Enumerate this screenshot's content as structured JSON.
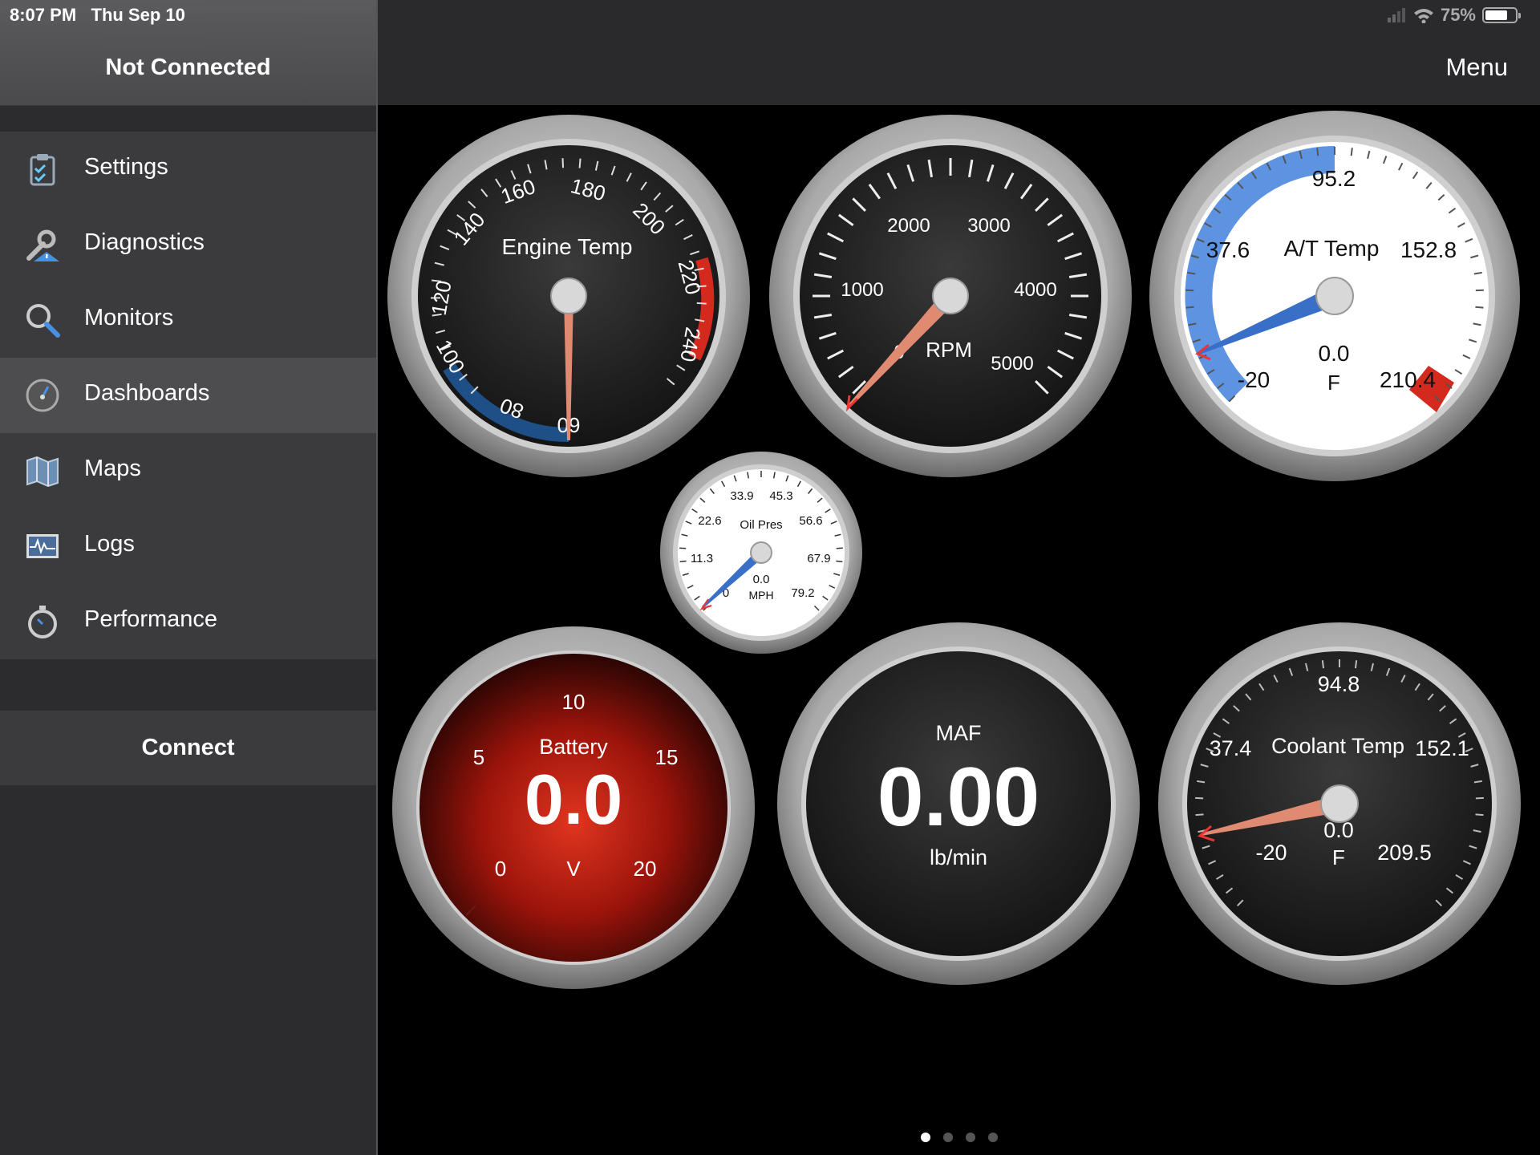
{
  "status_bar": {
    "time": "8:07 PM",
    "date": "Thu Sep 10",
    "battery": "75%",
    "battery_level": 0.75
  },
  "sidebar": {
    "title": "Not Connected",
    "items": [
      {
        "label": "Settings",
        "icon": "clipboard-check-icon",
        "active": false
      },
      {
        "label": "Diagnostics",
        "icon": "wrench-warning-icon",
        "active": false
      },
      {
        "label": "Monitors",
        "icon": "magnifier-icon",
        "active": false
      },
      {
        "label": "Dashboards",
        "icon": "speedometer-icon",
        "active": true
      },
      {
        "label": "Maps",
        "icon": "map-icon",
        "active": false
      },
      {
        "label": "Logs",
        "icon": "waveform-icon",
        "active": false
      },
      {
        "label": "Performance",
        "icon": "stopwatch-icon",
        "active": false
      }
    ],
    "connect_label": "Connect"
  },
  "header": {
    "menu_label": "Menu"
  },
  "gauges": {
    "engine_temp": {
      "title": "Engine Temp",
      "ticks": [
        "60",
        "80",
        "100",
        "120",
        "140",
        "160",
        "180",
        "200",
        "220",
        "240"
      ],
      "value": 60
    },
    "rpm": {
      "title": "RPM",
      "ticks": [
        "0",
        "1000",
        "2000",
        "3000",
        "4000",
        "5000"
      ],
      "value": 0
    },
    "at_temp": {
      "title": "A/T Temp",
      "ticks": [
        "-20",
        "37.6",
        "95.2",
        "152.8",
        "210.4"
      ],
      "value": "0.0",
      "unit": "F"
    },
    "oil_pres": {
      "title": "Oil Pres",
      "ticks": [
        "0",
        "11.3",
        "22.6",
        "33.9",
        "45.3",
        "56.6",
        "67.9",
        "79.2"
      ],
      "value": "0.0",
      "unit": "MPH"
    },
    "battery": {
      "title": "Battery",
      "ticks": [
        "0",
        "5",
        "10",
        "15",
        "20"
      ],
      "value": "0.0",
      "unit": "V"
    },
    "maf": {
      "title": "MAF",
      "value": "0.00",
      "unit": "lb/min"
    },
    "coolant_temp": {
      "title": "Coolant Temp",
      "ticks": [
        "-20",
        "37.4",
        "94.8",
        "152.1",
        "209.5"
      ],
      "value": "0.0",
      "unit": "F"
    }
  },
  "pager": {
    "pages": 4,
    "current": 1
  },
  "colors": {
    "accent_blue": "#3a6fc8",
    "redline": "#d42a1e",
    "needle": "#e08a72",
    "battery_face": "#b01a10"
  }
}
